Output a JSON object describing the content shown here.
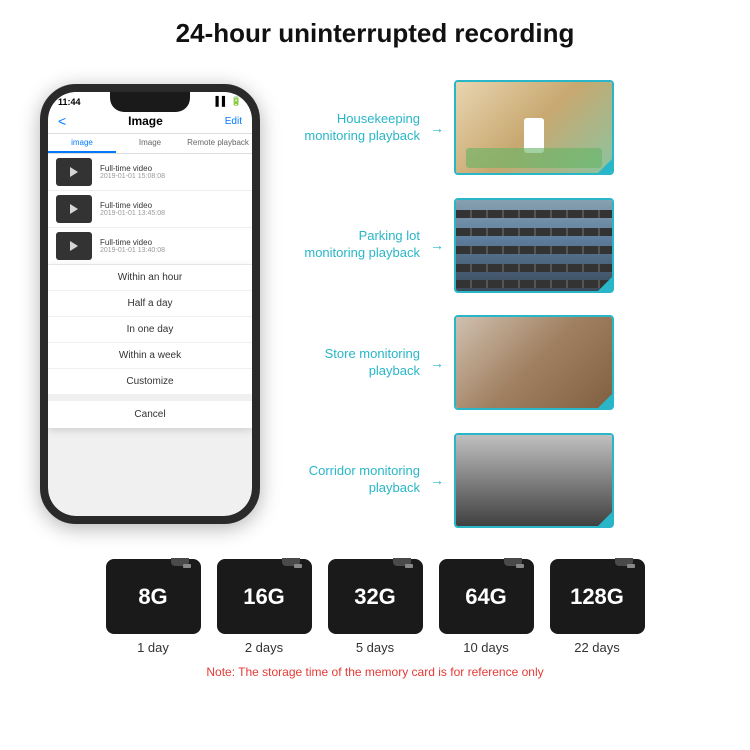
{
  "header": {
    "title": "24-hour uninterrupted recording"
  },
  "phone": {
    "time": "11:44",
    "signal": "▌▌▌",
    "back": "<",
    "screen_title": "Image",
    "edit": "Edit",
    "tabs": [
      "image",
      "Image",
      "Remote playback"
    ],
    "videos": [
      {
        "title": "Full-time video",
        "date": "2019-01-01 15:08:08"
      },
      {
        "title": "Full-time video",
        "date": "2019-01-01 13:45:08"
      },
      {
        "title": "Full-time video",
        "date": "2019-01-01 13:40:08"
      }
    ],
    "menu_items": [
      "Within an hour",
      "Half a day",
      "In one day",
      "Within a week",
      "Customize"
    ],
    "cancel": "Cancel"
  },
  "monitoring": [
    {
      "label": "Housekeeping\nmonitoring playback",
      "type": "housekeeping"
    },
    {
      "label": "Parking lot\nmonitoring playback",
      "type": "parking"
    },
    {
      "label": "Store monitoring\nplayback",
      "type": "store"
    },
    {
      "label": "Corridor monitoring\nplayback",
      "type": "corridor"
    }
  ],
  "storage": {
    "cards": [
      {
        "capacity": "8G",
        "days": "1 day"
      },
      {
        "capacity": "16G",
        "days": "2 days"
      },
      {
        "capacity": "32G",
        "days": "5 days"
      },
      {
        "capacity": "64G",
        "days": "10 days"
      },
      {
        "capacity": "128G",
        "days": "22 days"
      }
    ],
    "note": "Note: The storage time of the memory card is for reference only"
  }
}
